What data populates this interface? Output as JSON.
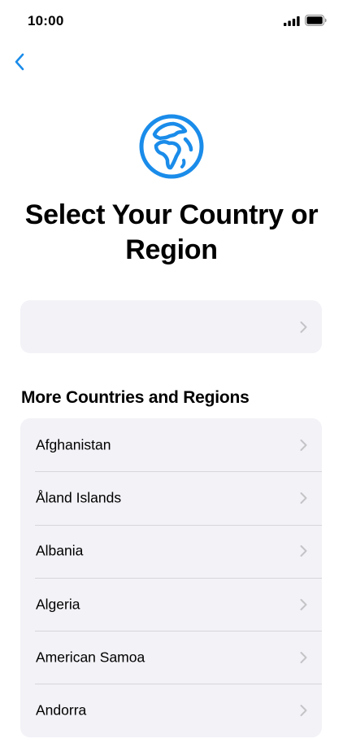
{
  "status_bar": {
    "time": "10:00",
    "signal_icon": "cellular-signal-icon",
    "battery_icon": "battery-full-icon"
  },
  "navigation": {
    "back_icon": "chevron-left-icon"
  },
  "header": {
    "icon": "globe-icon",
    "title": "Select Your Country or Region"
  },
  "suggested": {
    "label": "",
    "chevron_icon": "chevron-right-icon"
  },
  "section": {
    "title": "More Countries and Regions"
  },
  "countries": [
    {
      "label": "Afghanistan"
    },
    {
      "label": "Åland Islands"
    },
    {
      "label": "Albania"
    },
    {
      "label": "Algeria"
    },
    {
      "label": "American Samoa"
    },
    {
      "label": "Andorra"
    }
  ],
  "colors": {
    "accent": "#1a8cea",
    "card_background": "#f2f2f7",
    "chevron": "#c4c4c7",
    "separator": "#d6d6db"
  }
}
